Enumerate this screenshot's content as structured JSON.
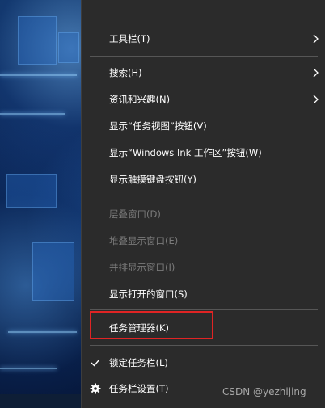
{
  "menu": {
    "items": [
      {
        "label": "工具栏(T)",
        "has_submenu": true,
        "disabled": false
      },
      {
        "label": "搜索(H)",
        "has_submenu": true,
        "disabled": false
      },
      {
        "label": "资讯和兴趣(N)",
        "has_submenu": true,
        "disabled": false
      },
      {
        "label": "显示“任务视图”按钮(V)",
        "has_submenu": false,
        "disabled": false
      },
      {
        "label": "显示“Windows Ink 工作区”按钮(W)",
        "has_submenu": false,
        "disabled": false
      },
      {
        "label": "显示触摸键盘按钮(Y)",
        "has_submenu": false,
        "disabled": false
      },
      {
        "label": "层叠窗口(D)",
        "has_submenu": false,
        "disabled": true
      },
      {
        "label": "堆叠显示窗口(E)",
        "has_submenu": false,
        "disabled": true
      },
      {
        "label": "并排显示窗口(I)",
        "has_submenu": false,
        "disabled": true
      },
      {
        "label": "显示打开的窗口(S)",
        "has_submenu": false,
        "disabled": false
      },
      {
        "label": "任务管理器(K)",
        "has_submenu": false,
        "disabled": false,
        "highlighted": true
      },
      {
        "label": "锁定任务栏(L)",
        "has_submenu": false,
        "disabled": false,
        "checked": true,
        "icon": "checkmark-icon"
      },
      {
        "label": "任务栏设置(T)",
        "has_submenu": false,
        "disabled": false,
        "icon": "gear-icon"
      }
    ]
  },
  "watermark": "CSDN @yezhijing",
  "colors": {
    "menu_background": "#2b2b2b",
    "text": "#ffffff",
    "disabled_text": "#7a7a7a",
    "separator": "#565656",
    "highlight_border": "#e02424"
  }
}
